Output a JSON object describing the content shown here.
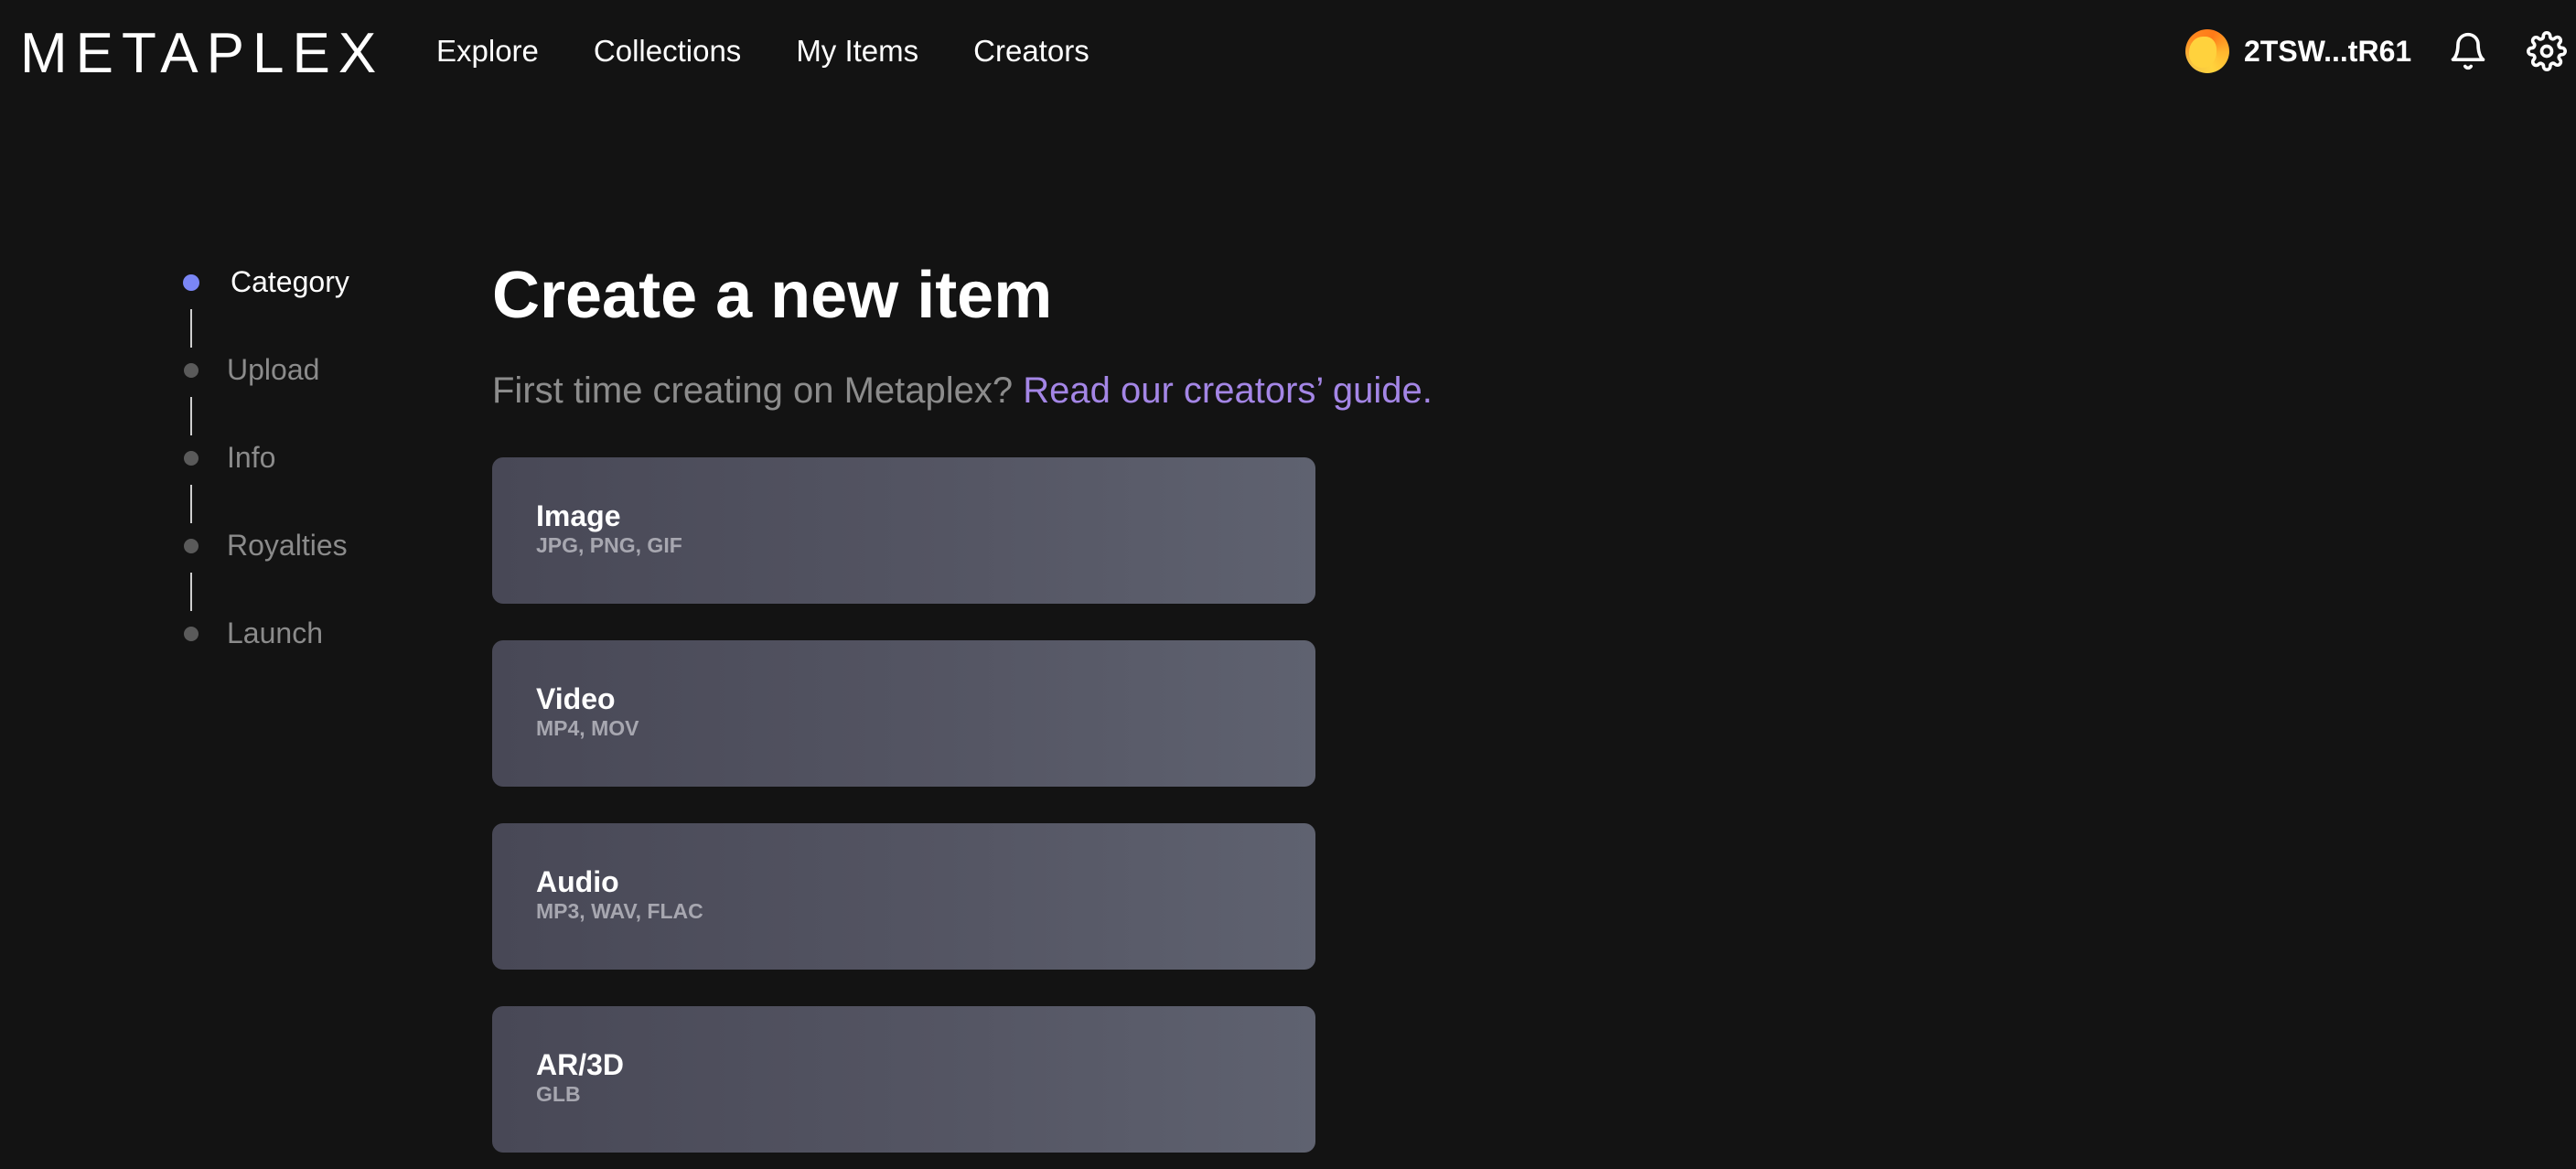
{
  "header": {
    "logo": "METAPLEX",
    "nav": [
      "Explore",
      "Collections",
      "My Items",
      "Creators"
    ],
    "wallet_address": "2TSW...tR61"
  },
  "stepper": {
    "steps": [
      "Category",
      "Upload",
      "Info",
      "Royalties",
      "Launch"
    ],
    "active_step": "Category"
  },
  "main": {
    "title": "Create a new item",
    "subtitle": "First time creating on Metaplex?",
    "guide_link": "Read our creators’ guide.",
    "categories": [
      {
        "title": "Image",
        "formats": "JPG, PNG, GIF"
      },
      {
        "title": "Video",
        "formats": "MP4, MOV"
      },
      {
        "title": "Audio",
        "formats": "MP3, WAV, FLAC"
      },
      {
        "title": "AR/3D",
        "formats": "GLB"
      }
    ]
  },
  "colors": {
    "background": "#131313",
    "active_step": "#7a86f5",
    "link": "#a486e6",
    "card": "#545563"
  },
  "icons": [
    "bell-icon",
    "gear-icon",
    "wallet-avatar"
  ]
}
